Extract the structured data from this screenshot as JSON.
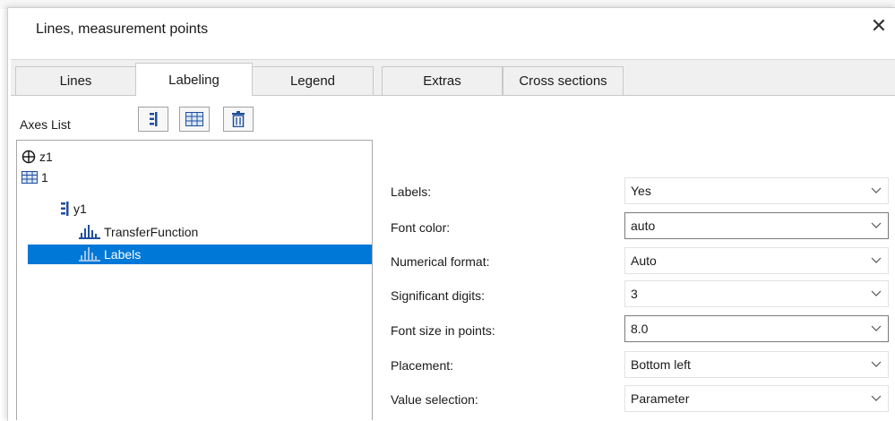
{
  "dialog": {
    "title": "Lines, measurement points",
    "close_glyph": "✕"
  },
  "tabs": [
    {
      "label": "Lines",
      "active": false
    },
    {
      "label": "Labeling",
      "active": true
    },
    {
      "label": "Legend",
      "active": false
    },
    {
      "label": "Extras",
      "active": false
    },
    {
      "label": "Cross sections",
      "active": false
    }
  ],
  "axes_list": {
    "label": "Axes List",
    "toolbar": [
      {
        "icon": "y-axis-icon"
      },
      {
        "icon": "table-icon"
      },
      {
        "icon": "trash-icon"
      }
    ],
    "tree": [
      {
        "icon": "crosshair-circle-icon",
        "label": "z1",
        "selected": false
      },
      {
        "icon": "table-icon",
        "label": "1",
        "selected": false
      },
      {
        "icon": "y-axis-icon",
        "label": "y1",
        "selected": false
      },
      {
        "icon": "bar-chart-icon",
        "label": "TransferFunction",
        "selected": false
      },
      {
        "icon": "bar-chart-icon",
        "label": "Labels",
        "selected": true
      }
    ]
  },
  "properties": [
    {
      "label": "Labels:",
      "value": "Yes",
      "framed": false
    },
    {
      "label": "Font color:",
      "value": "auto",
      "framed": true
    },
    {
      "label": "Numerical format:",
      "value": "Auto",
      "framed": false
    },
    {
      "label": "Significant digits:",
      "value": "3",
      "framed": false
    },
    {
      "label": "Font size in points:",
      "value": "8.0",
      "framed": true
    },
    {
      "label": "Placement:",
      "value": "Bottom left",
      "framed": false
    },
    {
      "label": "Value selection:",
      "value": "Parameter",
      "framed": false
    }
  ],
  "colors": {
    "selection": "#0078d7",
    "icon_blue": "#1f4e9e",
    "tab_band": "#f0f0f0"
  }
}
